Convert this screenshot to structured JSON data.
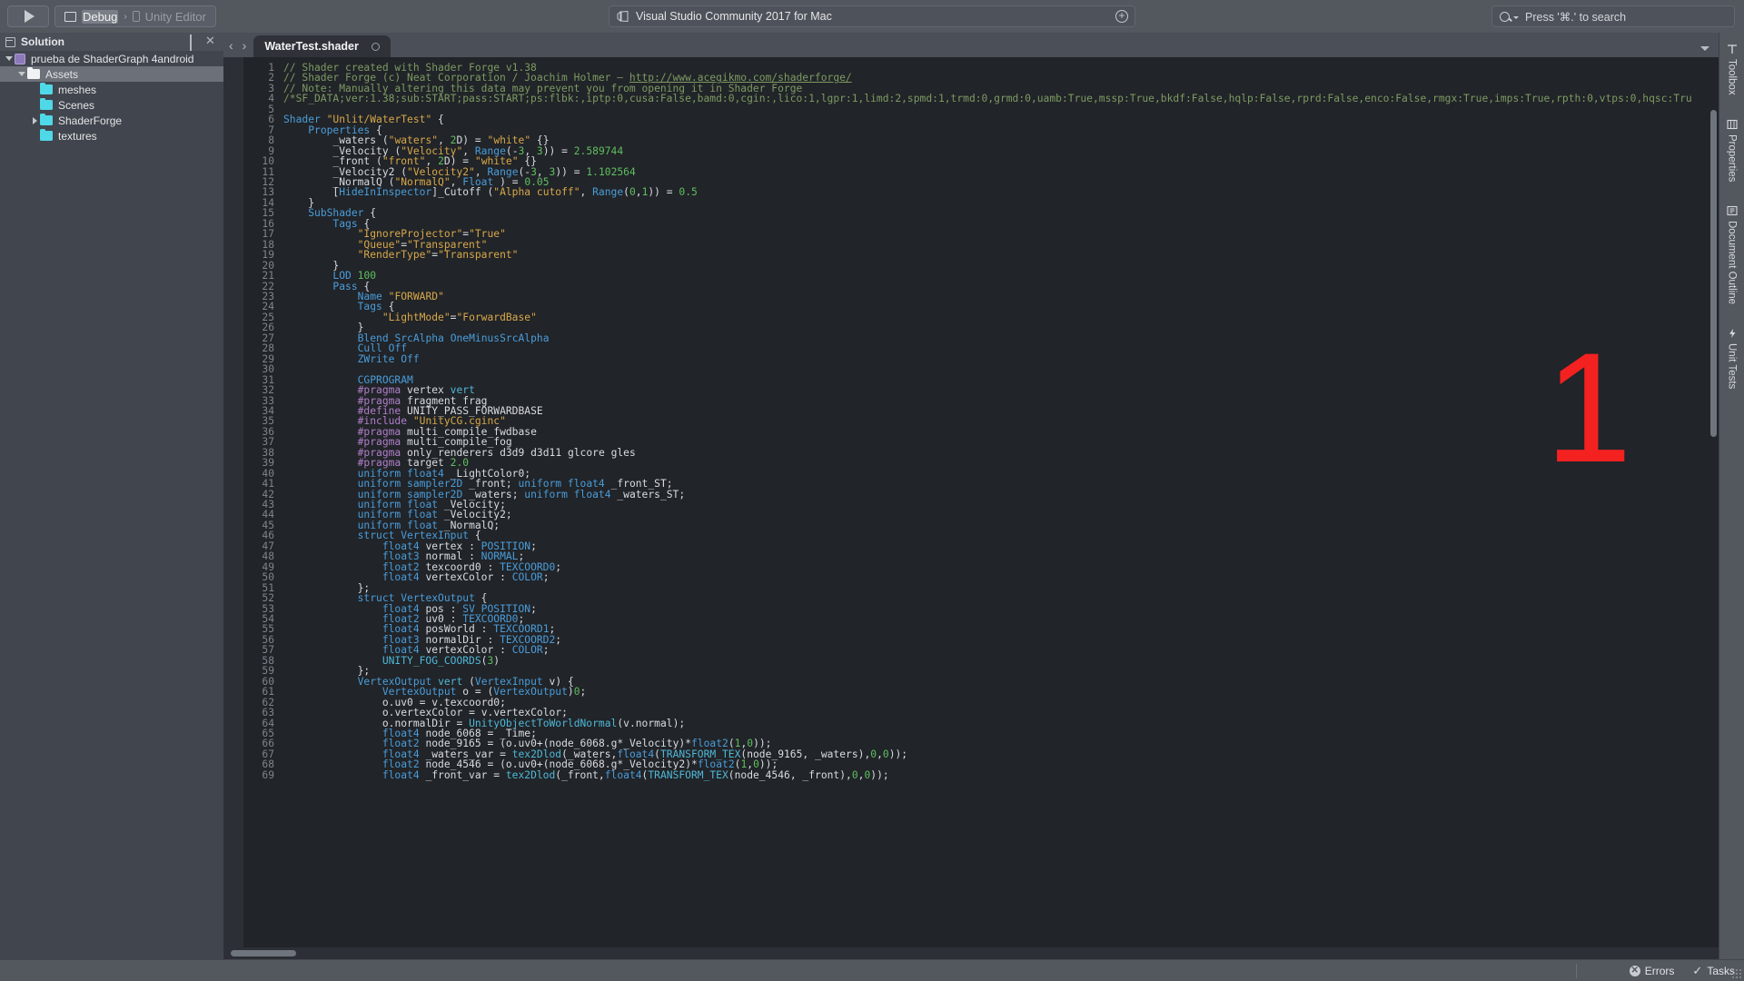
{
  "titlebar": {
    "run_button_icon": "play-icon",
    "configuration": "Debug",
    "configuration_icon": "monitor-icon",
    "separator": "›",
    "target": "Unity Editor",
    "target_icon": "device-icon",
    "status_text": "Visual Studio Community 2017 for Mac",
    "status_icon": "vs-logo-icon",
    "status_action_icon": "plus-circle-icon",
    "search_icon": "search-icon",
    "search_placeholder": "Press '⌘.' to search"
  },
  "solution_pad": {
    "title": "Solution",
    "title_icon": "solution-icon",
    "pin_icon": "pin-icon",
    "close_icon": "close-icon",
    "items": [
      {
        "label": "prueba de ShaderGraph 4android",
        "icon": "project-icon",
        "twisty": "down",
        "indent": 0,
        "selected": false
      },
      {
        "label": "Assets",
        "icon": "folder-white-icon",
        "twisty": "down",
        "indent": 1,
        "selected": true
      },
      {
        "label": "meshes",
        "icon": "folder-cyan-icon",
        "twisty": "none",
        "indent": 2,
        "selected": false
      },
      {
        "label": "Scenes",
        "icon": "folder-cyan-icon",
        "twisty": "none",
        "indent": 2,
        "selected": false
      },
      {
        "label": "ShaderForge",
        "icon": "folder-cyan-icon",
        "twisty": "right",
        "indent": 2,
        "selected": false
      },
      {
        "label": "textures",
        "icon": "folder-cyan-icon",
        "twisty": "none",
        "indent": 2,
        "selected": false
      }
    ]
  },
  "editor": {
    "back_icon": "chevron-left-icon",
    "forward_icon": "chevron-right-icon",
    "tab_label": "WaterTest.shader",
    "tab_close_icon": "circle-icon",
    "tab_overflow_icon": "chevron-down-icon",
    "overlay_number": "1",
    "overlay_color": "#f42121",
    "first_line_number": 1,
    "lines": [
      "// Shader created with Shader Forge v1.38",
      "// Shader Forge (c) Neat Corporation / Joachim Holmer – http://www.acegikmo.com/shaderforge/",
      "// Note: Manually altering this data may prevent you from opening it in Shader Forge",
      "/*SF_DATA;ver:1.38;sub:START;pass:START;ps:flbk:,iptp:0,cusa:False,bamd:0,cgin:,lico:1,lgpr:1,limd:2,spmd:1,trmd:0,grmd:0,uamb:True,mssp:True,bkdf:False,hqlp:False,rprd:False,enco:False,rmgx:True,imps:True,rpth:0,vtps:0,hqsc:Tru",
      "",
      "Shader \"Unlit/WaterTest\" {",
      "    Properties {",
      "        _waters (\"waters\", 2D) = \"white\" {}",
      "        _Velocity (\"Velocity\", Range(-3, 3)) = 2.589744",
      "        _front (\"front\", 2D) = \"white\" {}",
      "        _Velocity2 (\"Velocity2\", Range(-3, 3)) = 1.102564",
      "        _NormalQ (\"NormalQ\", Float ) = 0.05",
      "        [HideInInspector]_Cutoff (\"Alpha cutoff\", Range(0,1)) = 0.5",
      "    }",
      "    SubShader {",
      "        Tags {",
      "            \"IgnoreProjector\"=\"True\"",
      "            \"Queue\"=\"Transparent\"",
      "            \"RenderType\"=\"Transparent\"",
      "        }",
      "        LOD 100",
      "        Pass {",
      "            Name \"FORWARD\"",
      "            Tags {",
      "                \"LightMode\"=\"ForwardBase\"",
      "            }",
      "            Blend SrcAlpha OneMinusSrcAlpha",
      "            Cull Off",
      "            ZWrite Off",
      "",
      "            CGPROGRAM",
      "            #pragma vertex vert",
      "            #pragma fragment frag",
      "            #define UNITY_PASS_FORWARDBASE",
      "            #include \"UnityCG.cginc\"",
      "            #pragma multi_compile_fwdbase",
      "            #pragma multi_compile_fog",
      "            #pragma only_renderers d3d9 d3d11 glcore gles",
      "            #pragma target 2.0",
      "            uniform float4 _LightColor0;",
      "            uniform sampler2D _front; uniform float4 _front_ST;",
      "            uniform sampler2D _waters; uniform float4 _waters_ST;",
      "            uniform float _Velocity;",
      "            uniform float _Velocity2;",
      "            uniform float _NormalQ;",
      "            struct VertexInput {",
      "                float4 vertex : POSITION;",
      "                float3 normal : NORMAL;",
      "                float2 texcoord0 : TEXCOORD0;",
      "                float4 vertexColor : COLOR;",
      "            };",
      "            struct VertexOutput {",
      "                float4 pos : SV_POSITION;",
      "                float2 uv0 : TEXCOORD0;",
      "                float4 posWorld : TEXCOORD1;",
      "                float3 normalDir : TEXCOORD2;",
      "                float4 vertexColor : COLOR;",
      "                UNITY_FOG_COORDS(3)",
      "            };",
      "            VertexOutput vert (VertexInput v) {",
      "                VertexOutput o = (VertexOutput)0;",
      "                o.uv0 = v.texcoord0;",
      "                o.vertexColor = v.vertexColor;",
      "                o.normalDir = UnityObjectToWorldNormal(v.normal);",
      "                float4 node_6068 = _Time;",
      "                float2 node_9165 = (o.uv0+(node_6068.g*_Velocity)*float2(1,0));",
      "                float4 _waters_var = tex2Dlod(_waters,float4(TRANSFORM_TEX(node_9165, _waters),0,0));",
      "                float2 node_4546 = (o.uv0+(node_6068.g*_Velocity2)*float2(1,0));",
      "                float4 _front_var = tex2Dlod(_front,float4(TRANSFORM_TEX(node_4546, _front),0,0));"
    ]
  },
  "right_toolbar": {
    "items": [
      {
        "label": "Toolbox",
        "icon": "toolbox-icon"
      },
      {
        "label": "Properties",
        "icon": "properties-icon"
      },
      {
        "label": "Document Outline",
        "icon": "document-outline-icon"
      },
      {
        "label": "Unit Tests",
        "icon": "unit-tests-icon"
      }
    ]
  },
  "statusbar": {
    "errors_label": "Errors",
    "errors_icon": "error-circle-icon",
    "tasks_label": "Tasks",
    "tasks_icon": "check-icon",
    "resize_grip_icon": "resize-grip-icon"
  }
}
